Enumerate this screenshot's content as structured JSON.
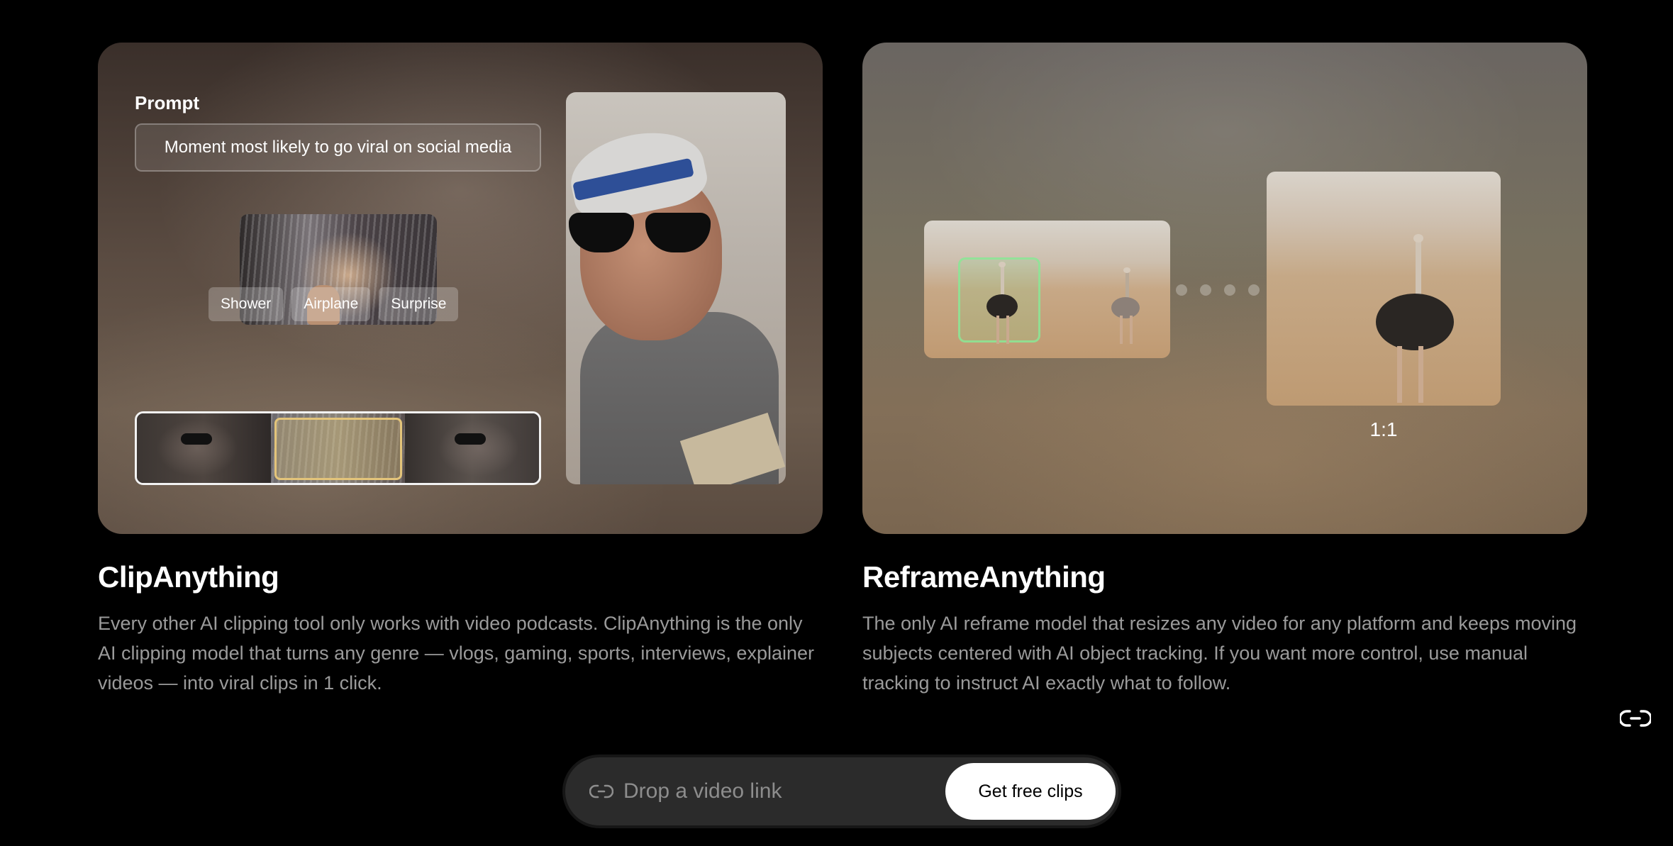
{
  "clip_card": {
    "prompt_label": "Prompt",
    "prompt_value": "Moment most likely to go viral on social media",
    "tags": [
      "Shower",
      "Airplane",
      "Surprise"
    ]
  },
  "reframe_card": {
    "ratio_label": "1:1"
  },
  "features": [
    {
      "title": "ClipAnything",
      "description": "Every other AI clipping tool only works with video podcasts. ClipAnything is the only AI clipping model that turns any genre — vlogs, gaming, sports, interviews, explainer videos — into viral clips in 1 click."
    },
    {
      "title": "ReframeAnything",
      "description": "The only AI reframe model that resizes any video for any platform and keeps moving subjects centered with AI object tracking. If you want more control, use manual tracking to instruct AI exactly what to follow."
    }
  ],
  "drop_bar": {
    "placeholder": "Drop a video link",
    "cta_label": "Get free clips",
    "icon": "link-icon"
  },
  "side_icon": "link-icon",
  "colors": {
    "background": "#000000",
    "cta_background": "#ffffff",
    "tracking_box": "#8ce696",
    "timeline_highlight": "#e3c47a"
  }
}
